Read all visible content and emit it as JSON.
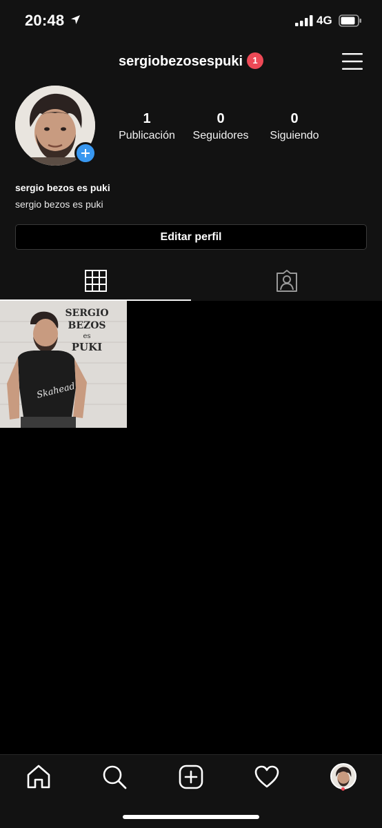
{
  "status_bar": {
    "time": "20:48",
    "network": "4G",
    "icons": [
      "location-arrow-icon",
      "signal-bars-icon",
      "battery-icon"
    ]
  },
  "header": {
    "username": "sergiobezosespuki",
    "notification_count": "1",
    "icons": [
      "menu-icon"
    ]
  },
  "profile": {
    "avatar_icon": "profile-photo",
    "add_story_icon": "plus-icon",
    "stats": [
      {
        "count": "1",
        "label": "Publicación"
      },
      {
        "count": "0",
        "label": "Seguidores"
      },
      {
        "count": "0",
        "label": "Siguiendo"
      }
    ],
    "display_name": "sergio bezos es puki",
    "bio": "sergio bezos es puki",
    "edit_button": "Editar perfil"
  },
  "tabs": [
    {
      "icon": "grid-icon",
      "active": true
    },
    {
      "icon": "tagged-icon",
      "active": false
    }
  ],
  "posts": [
    {
      "title_lines": [
        "SERGIO",
        "BEZOS",
        "es",
        "PUKI"
      ],
      "shirt_text": "Skahead"
    }
  ],
  "bottom_nav": {
    "items": [
      "home-icon",
      "search-icon",
      "new-post-icon",
      "activity-heart-icon",
      "profile-avatar-icon"
    ]
  },
  "colors": {
    "background": "#000000",
    "panel": "#121212",
    "badge": "#ed4956",
    "add_story": "#3897f0",
    "text": "#ffffff"
  }
}
